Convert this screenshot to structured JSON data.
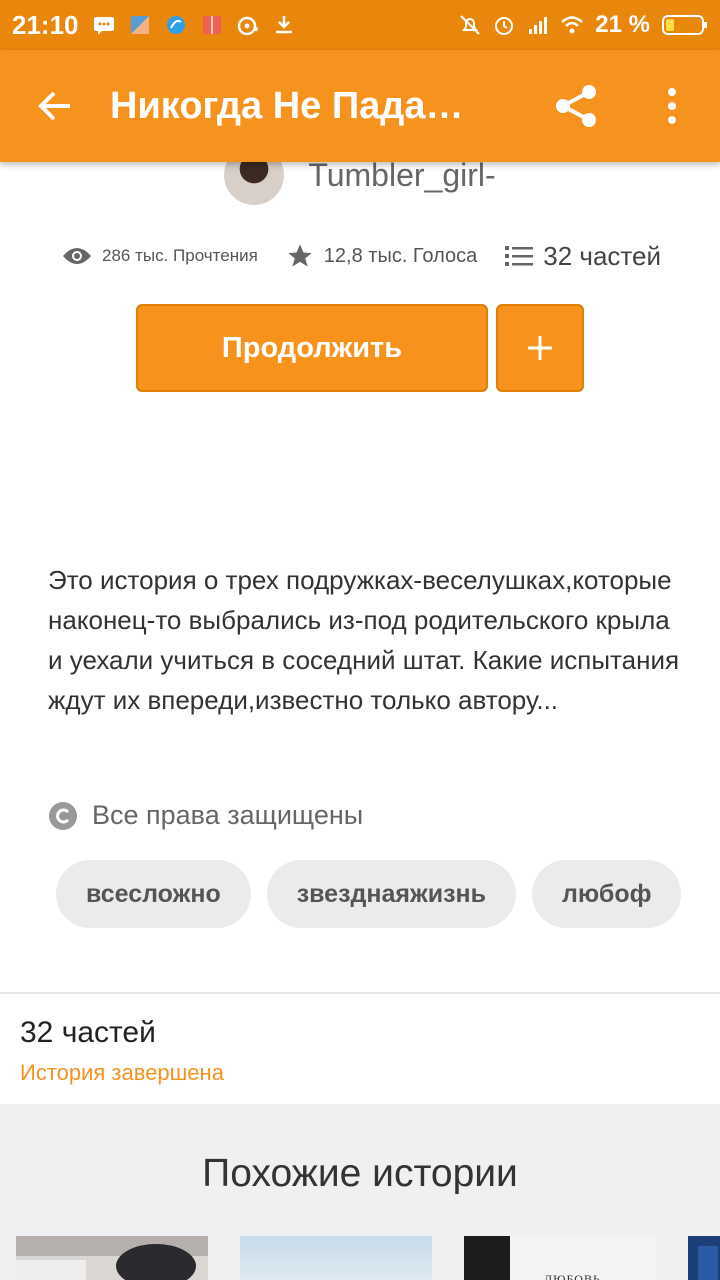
{
  "status_bar": {
    "time": "21:10",
    "battery": "21 %"
  },
  "app_bar": {
    "title": "Никогда Не Пада…"
  },
  "author": {
    "name": "Tumbler_girl-"
  },
  "stats": {
    "reads": "286 тыс. Прочтения",
    "votes": "12,8 тыс. Голоса",
    "parts": "32 частей"
  },
  "actions": {
    "continue_label": "Продолжить",
    "add_label": "+"
  },
  "description": "Это история о трех подружках-веселушках,которые наконец-то выбрались из-под  родительского крыла и уехали учиться в соседний штат. Какие испытания ждут их впереди,известно только автору...",
  "rights": "Все права защищены",
  "tags": [
    "всесложно",
    "звезднаяжизнь",
    "любоф"
  ],
  "parts_info": {
    "count": "32 частей",
    "status": "История завершена"
  },
  "similar": {
    "title": "Похожие истории",
    "cover_text": "ЛЮБОВЬ"
  },
  "colors": {
    "status_bar": "#e8870c",
    "app_bar": "#f6921e",
    "accent": "#f7931d"
  }
}
